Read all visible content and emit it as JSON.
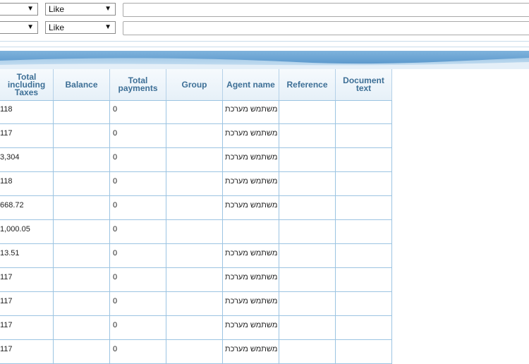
{
  "filters": [
    {
      "field": "",
      "operator": "Like",
      "value": ""
    },
    {
      "field": "",
      "operator": "Like",
      "value": ""
    }
  ],
  "grid": {
    "columns": [
      "Total including Taxes",
      "Balance",
      "Total payments",
      "Group",
      "Agent name",
      "Reference",
      "Document text"
    ],
    "rows": [
      {
        "total": "118",
        "balance": "",
        "payments": "0",
        "group": "",
        "agent": "משתמש מערכת",
        "reference": "",
        "doc_text": ""
      },
      {
        "total": "117",
        "balance": "",
        "payments": "0",
        "group": "",
        "agent": "משתמש מערכת",
        "reference": "",
        "doc_text": ""
      },
      {
        "total": "3,304",
        "balance": "",
        "payments": "0",
        "group": "",
        "agent": "משתמש מערכת",
        "reference": "",
        "doc_text": ""
      },
      {
        "total": "118",
        "balance": "",
        "payments": "0",
        "group": "",
        "agent": "משתמש מערכת",
        "reference": "",
        "doc_text": ""
      },
      {
        "total": "668.72",
        "balance": "",
        "payments": "0",
        "group": "",
        "agent": "משתמש מערכת",
        "reference": "",
        "doc_text": ""
      },
      {
        "total": "1,000.05",
        "balance": "",
        "payments": "0",
        "group": "",
        "agent": "",
        "reference": "",
        "doc_text": ""
      },
      {
        "total": "13.51",
        "balance": "",
        "payments": "0",
        "group": "",
        "agent": "משתמש מערכת",
        "reference": "",
        "doc_text": ""
      },
      {
        "total": "117",
        "balance": "",
        "payments": "0",
        "group": "",
        "agent": "משתמש מערכת",
        "reference": "",
        "doc_text": ""
      },
      {
        "total": "117",
        "balance": "",
        "payments": "0",
        "group": "",
        "agent": "משתמש מערכת",
        "reference": "",
        "doc_text": ""
      },
      {
        "total": "117",
        "balance": "",
        "payments": "0",
        "group": "",
        "agent": "משתמש מערכת",
        "reference": "",
        "doc_text": ""
      },
      {
        "total": "117",
        "balance": "",
        "payments": "0",
        "group": "",
        "agent": "משתמש מערכת",
        "reference": "",
        "doc_text": ""
      }
    ]
  },
  "icons": {
    "caret": "dropdown-caret-icon"
  },
  "colors": {
    "header_text": "#3d6f96",
    "grid_border": "#9cc4e2",
    "band": "#5b9bd0"
  }
}
